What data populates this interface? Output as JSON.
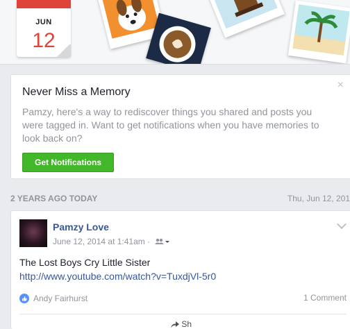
{
  "banner": {
    "calendar_month": "JUN",
    "calendar_day": "12"
  },
  "memory_card": {
    "title": "Never Miss a Memory",
    "close_label": "×",
    "description": "Pamzy, here's a way to rediscover things you shared and posts you were tagged in. Want to get notifications when you have memories to look back on?",
    "button_label": "Get Notifications"
  },
  "section": {
    "label": "2 YEARS AGO TODAY",
    "date": "Thu, Jun 12, 201"
  },
  "post": {
    "author": "Pamzy Love",
    "timestamp": "June 12, 2014 at 1:41am",
    "separator": "·",
    "text": "The Lost Boys Cry Little Sister",
    "link": "http://www.youtube.com/watch?v=TuxdjVl-5r0",
    "liker": "Andy Fairhurst",
    "comments": "1 Comment",
    "share_label": "Sh"
  },
  "colors": {
    "accent": "#365899",
    "button_green": "#42b72a",
    "calendar_red": "#e0433a",
    "like_blue": "#5890ff"
  }
}
